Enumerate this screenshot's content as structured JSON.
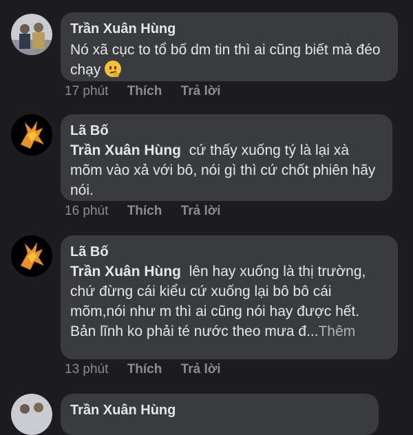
{
  "comments": [
    {
      "author": "Trần Xuân Hùng",
      "text": "Nó xã cục to tổ bố dm tin thì ai cũng biết mà đéo chạy",
      "emoji": "thinking-face",
      "time": "17 phút",
      "like": "Thích",
      "reply": "Trả lời"
    },
    {
      "author": "Lã Bố",
      "mention": "Trần Xuân Hùng",
      "text": "cứ thấy xuống tý là lại xà mõm vào xả với bô, nói gì thì cứ chốt phiên hãy nói.",
      "time": "16 phút",
      "like": "Thích",
      "reply": "Trả lời"
    },
    {
      "author": "Lã Bố",
      "mention": "Trần Xuân Hùng",
      "text": "lên hay xuống là thị trường, chứ đừng cái kiểu cứ xuống lại bô bô cái mõm,nói như m thì ai cũng nói hay được hết. Bản lĩnh ko phải té nước theo mưa đ...",
      "more": "Thêm",
      "time": "13 phút",
      "like": "Thích",
      "reply": "Trả lời"
    },
    {
      "author": "Trần Xuân Hùng"
    }
  ]
}
